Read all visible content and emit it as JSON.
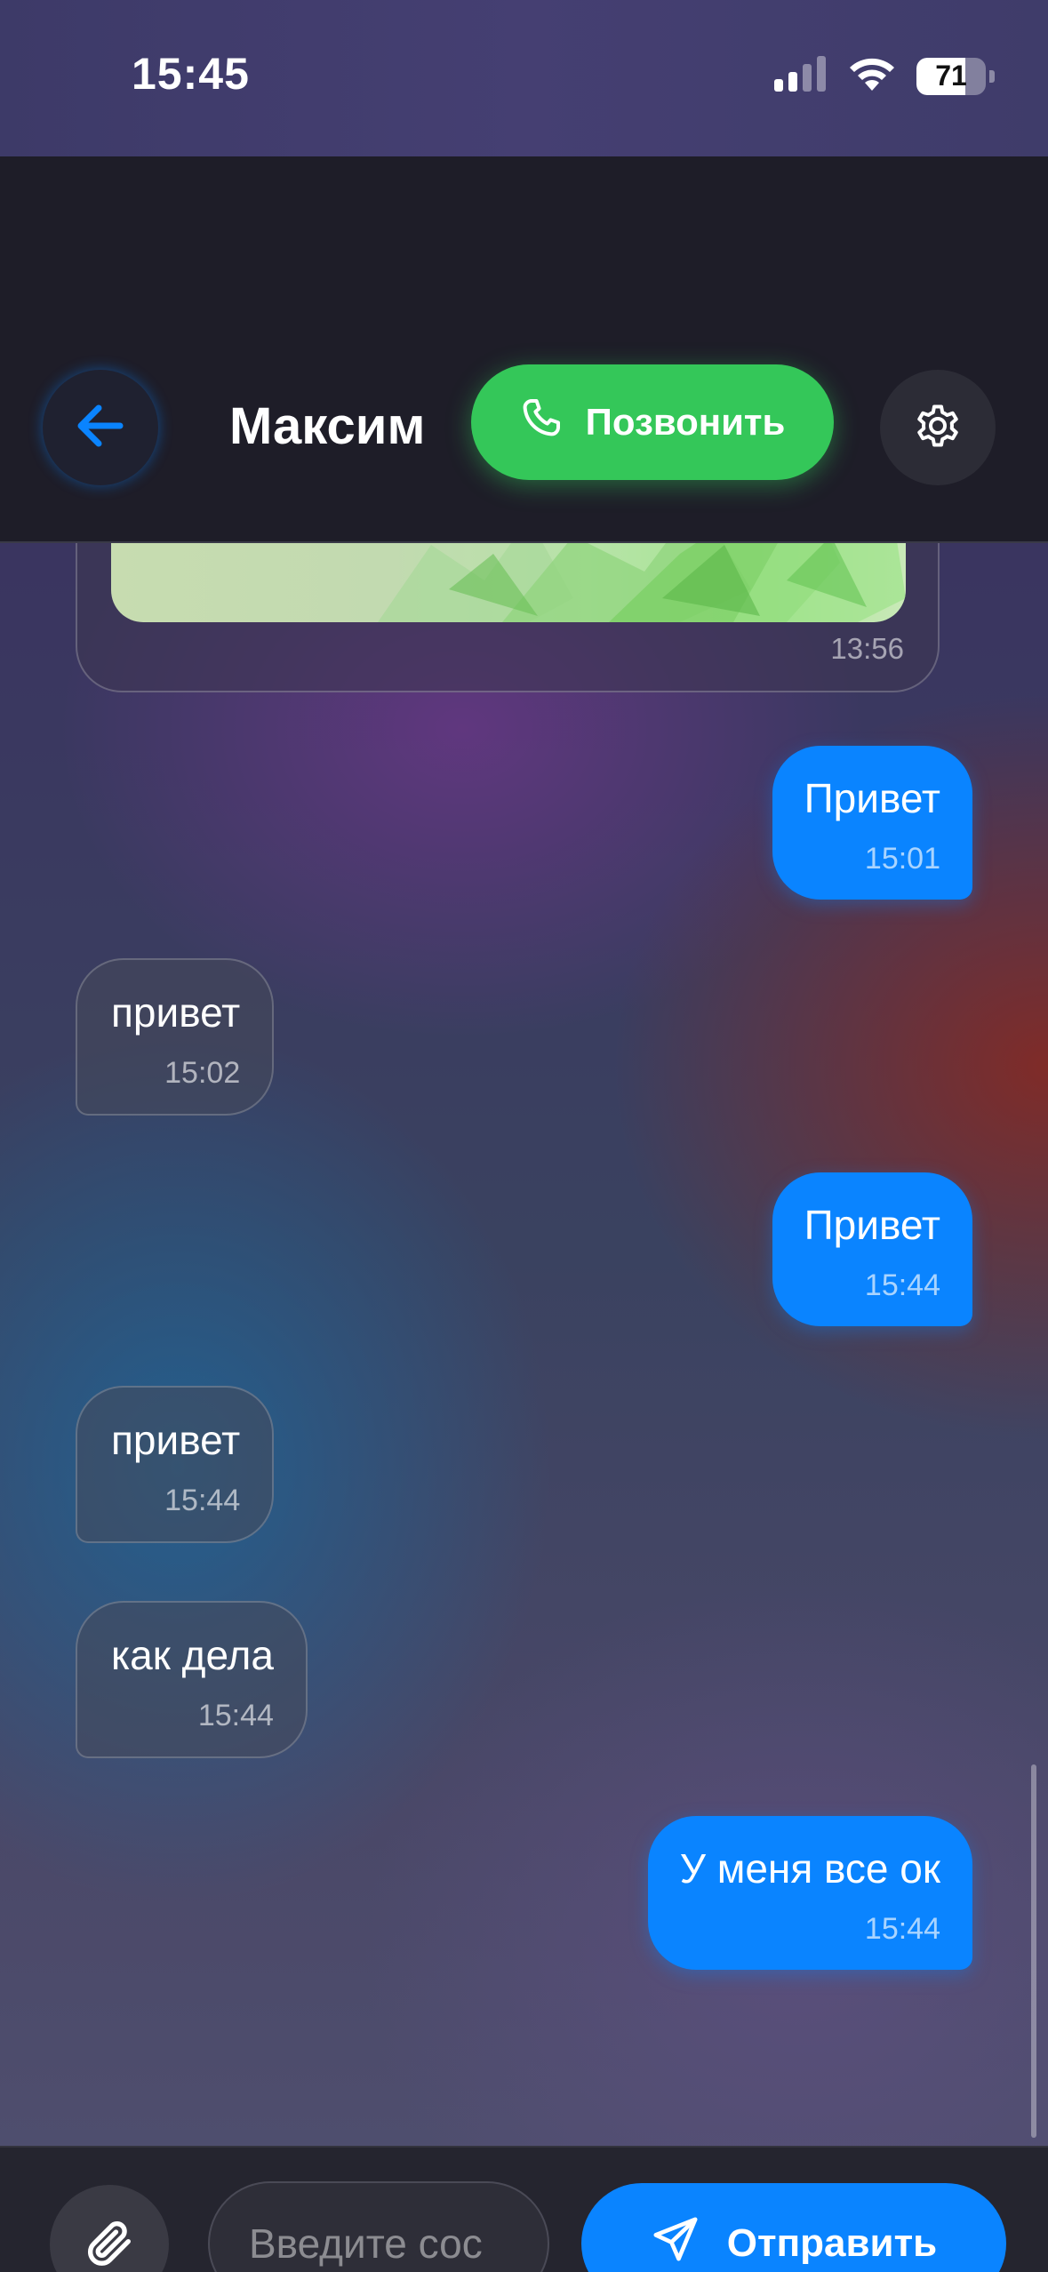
{
  "status_bar": {
    "time": "15:45",
    "battery_level": "71",
    "signal_icon": "cellular-signal-icon",
    "wifi_icon": "wifi-icon"
  },
  "header": {
    "back_icon": "arrow-left-icon",
    "contact_name": "Максим",
    "call_label": "Позвонить",
    "call_icon": "phone-icon",
    "settings_icon": "gear-icon"
  },
  "messages": {
    "image_message": {
      "time": "13:56"
    },
    "items": [
      {
        "direction": "outgoing",
        "text": "Привет",
        "time": "15:01"
      },
      {
        "direction": "incoming",
        "text": "привет",
        "time": "15:02"
      },
      {
        "direction": "outgoing",
        "text": "Привет",
        "time": "15:44"
      },
      {
        "direction": "incoming",
        "text": "привет",
        "time": "15:44"
      },
      {
        "direction": "incoming",
        "text": "как дела",
        "time": "15:44"
      },
      {
        "direction": "outgoing",
        "text": "У меня все ок",
        "time": "15:44"
      }
    ]
  },
  "composer": {
    "attach_icon": "paperclip-icon",
    "input_value": "",
    "input_placeholder": "Введите сос",
    "send_label": "Отправить",
    "send_icon": "paper-plane-icon"
  },
  "colors": {
    "accent": "#0a84ff",
    "call_green": "#34c759",
    "header_bg": "#1e1d28"
  }
}
